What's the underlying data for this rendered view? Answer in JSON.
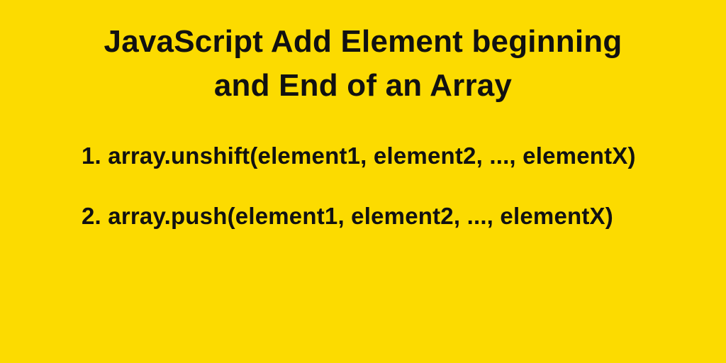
{
  "title_line1": "JavaScript Add Element beginning",
  "title_line2": "and End of an Array",
  "items": {
    "0": "1. array.unshift(element1, element2, ..., elementX)",
    "1": "2. array.push(element1, element2, ..., elementX)"
  }
}
